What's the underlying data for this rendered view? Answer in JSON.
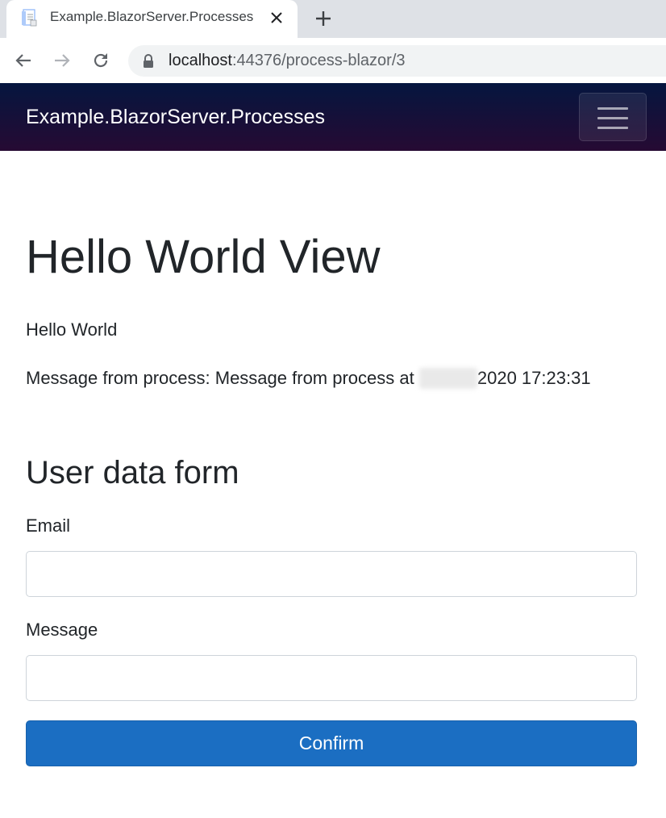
{
  "browser": {
    "tab": {
      "title": "Example.BlazorServer.Processes",
      "favicon": "document-icon"
    },
    "address": {
      "host": "localhost",
      "path": ":44376/process-blazor/3"
    }
  },
  "navbar": {
    "brand": "Example.BlazorServer.Processes",
    "toggler_icon": "hamburger-menu-icon"
  },
  "main": {
    "title": "Hello World View",
    "greeting": "Hello World",
    "message_prefix": "Message from process: Message from process at ",
    "message_suffix": "2020 17:23:31"
  },
  "form": {
    "title": "User data form",
    "email_label": "Email",
    "email_value": "",
    "message_label": "Message",
    "message_value": "",
    "confirm_label": "Confirm"
  },
  "colors": {
    "navbar_top": "#05163f",
    "navbar_bottom": "#260a33",
    "primary_button": "#1b6ec2"
  }
}
